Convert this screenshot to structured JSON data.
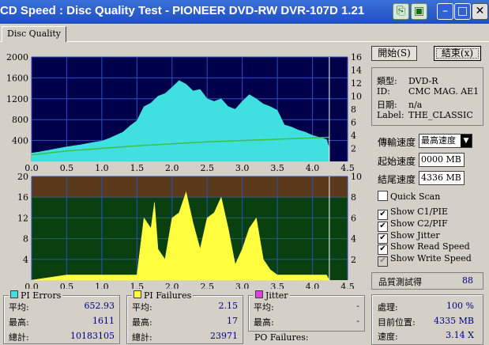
{
  "window": {
    "title": "CD Speed : Disc Quality Test - PIONEER DVD-RW  DVR-107D 1.21",
    "buttons": [
      "copy-icon",
      "save-icon",
      "minimize-icon",
      "maximize-icon",
      "close-icon"
    ]
  },
  "tabs": [
    {
      "label": "Disc Quality"
    }
  ],
  "actions": {
    "start": "開始(S)",
    "exit": "結束(x)"
  },
  "disc_info": {
    "type_label": "類型:",
    "type_value": "DVD-R",
    "id_label": "ID:",
    "id_value": "CMC MAG. AE1",
    "date_label": "日期:",
    "date_value": "n/a",
    "label_label": "Label:",
    "label_value": "THE_CLASSIC"
  },
  "settings": {
    "speed_label": "傳輸速度",
    "speed_value": "最高速度",
    "start_label": "起始速度",
    "start_value": "0000 MB",
    "end_label": "結尾速度",
    "end_value": "4336 MB"
  },
  "checkboxes": [
    {
      "label": "Quick Scan",
      "checked": false,
      "disabled": false
    },
    {
      "label": "Show C1/PIE",
      "checked": true,
      "disabled": false
    },
    {
      "label": "Show C2/PIF",
      "checked": true,
      "disabled": false
    },
    {
      "label": "Show Jitter",
      "checked": true,
      "disabled": false
    },
    {
      "label": "Show Read Speed",
      "checked": true,
      "disabled": false
    },
    {
      "label": "Show Write Speed",
      "checked": true,
      "disabled": true
    }
  ],
  "quality": {
    "label": "品質測試得",
    "value": "88"
  },
  "pi_errors": {
    "title": "PI Errors",
    "color": "#40e0e0",
    "avg_label": "平均:",
    "avg": "652.93",
    "max_label": "最高:",
    "max": "1611",
    "total_label": "總計:",
    "total": "10183105"
  },
  "pi_failures": {
    "title": "PI Failures",
    "color": "#ffff40",
    "avg_label": "平均:",
    "avg": "2.15",
    "max_label": "最高:",
    "max": "17",
    "total_label": "總計:",
    "total": "23971"
  },
  "jitter": {
    "title": "Jitter",
    "color": "#e040e0",
    "avg_label": "平均:",
    "avg": "-",
    "max_label": "最高:",
    "max": "-"
  },
  "po_failures": {
    "title": "PO Failures:"
  },
  "progress": {
    "elapsed_label": "處理:",
    "elapsed_value": "100 %",
    "pos_label": "目前位置:",
    "pos_value": "4335 MB",
    "speed_label": "速度:",
    "speed_value": "3.14 X"
  },
  "colors": {
    "pi_errors": "#40e0e0",
    "pi_failures": "#ffff40",
    "read_speed": "#40c040",
    "plot_bg_top": "#00004a",
    "plot_bg_bot": "#0a4010",
    "brown_band": "#5a3a1a"
  },
  "chart_data": [
    {
      "type": "area",
      "title": "",
      "x_ticks": [
        "0.0",
        "0.5",
        "1.0",
        "1.5",
        "2.0",
        "2.5",
        "3.0",
        "3.5",
        "4.0",
        "4.5"
      ],
      "y_left_ticks": [
        "2000",
        "1600",
        "1200",
        "800",
        "400"
      ],
      "y_right_ticks": [
        "16",
        "14",
        "12",
        "10",
        "8",
        "6",
        "4",
        "2"
      ],
      "xlim": [
        0,
        4.5
      ],
      "ylim": [
        0,
        2000
      ],
      "y2lim": [
        0,
        16
      ],
      "series": [
        {
          "values_x": [
            0.0,
            0.1,
            0.3,
            0.5,
            0.7,
            0.9,
            1.0,
            1.1,
            1.2,
            1.3,
            1.4,
            1.5,
            1.6,
            1.7,
            1.8,
            1.9,
            2.0,
            2.1,
            2.2,
            2.3,
            2.4,
            2.5,
            2.6,
            2.7,
            2.8,
            2.9,
            3.0,
            3.1,
            3.2,
            3.3,
            3.4,
            3.5,
            3.6,
            3.7,
            3.8,
            3.9,
            4.0,
            4.1,
            4.2,
            4.24
          ],
          "values": [
            160,
            180,
            230,
            280,
            320,
            370,
            390,
            440,
            500,
            560,
            680,
            780,
            1050,
            1120,
            1250,
            1300,
            1420,
            1550,
            1480,
            1350,
            1380,
            1200,
            1150,
            1200,
            1050,
            1000,
            1150,
            1280,
            1200,
            1100,
            1050,
            980,
            700,
            660,
            600,
            560,
            500,
            460,
            420,
            250
          ]
        },
        {
          "values_x": [
            0.0,
            0.5,
            1.0,
            1.5,
            2.0,
            2.5,
            3.0,
            3.5,
            4.0,
            4.24
          ],
          "values": [
            1.0,
            1.6,
            2.0,
            2.4,
            2.7,
            3.0,
            3.2,
            3.4,
            3.6,
            3.7
          ]
        }
      ]
    },
    {
      "type": "area",
      "title": "",
      "x_ticks": [
        "0.0",
        "0.5",
        "1.0",
        "1.5",
        "2.0",
        "2.5",
        "3.0",
        "3.5",
        "4.0",
        "4.5"
      ],
      "y_left_ticks": [
        "20",
        "16",
        "12",
        "8",
        "4"
      ],
      "y_right_ticks": [
        "10",
        "8",
        "6",
        "4",
        "2"
      ],
      "xlim": [
        0,
        4.5
      ],
      "ylim": [
        0,
        20
      ],
      "series": [
        {
          "values_x": [
            0.0,
            0.5,
            1.0,
            1.5,
            1.6,
            1.7,
            1.75,
            1.8,
            1.9,
            2.0,
            2.1,
            2.2,
            2.3,
            2.4,
            2.5,
            2.6,
            2.7,
            2.8,
            2.9,
            3.0,
            3.1,
            3.2,
            3.3,
            3.4,
            3.5,
            3.6,
            3.7,
            3.8,
            4.0,
            4.2,
            4.24
          ],
          "values": [
            0,
            1,
            1,
            1,
            12,
            10,
            15,
            6,
            4,
            12,
            13,
            17,
            11,
            6,
            12,
            13,
            16,
            10,
            3,
            6,
            10,
            12,
            4,
            2,
            1,
            1,
            1,
            1,
            1,
            1,
            0
          ]
        }
      ]
    }
  ]
}
